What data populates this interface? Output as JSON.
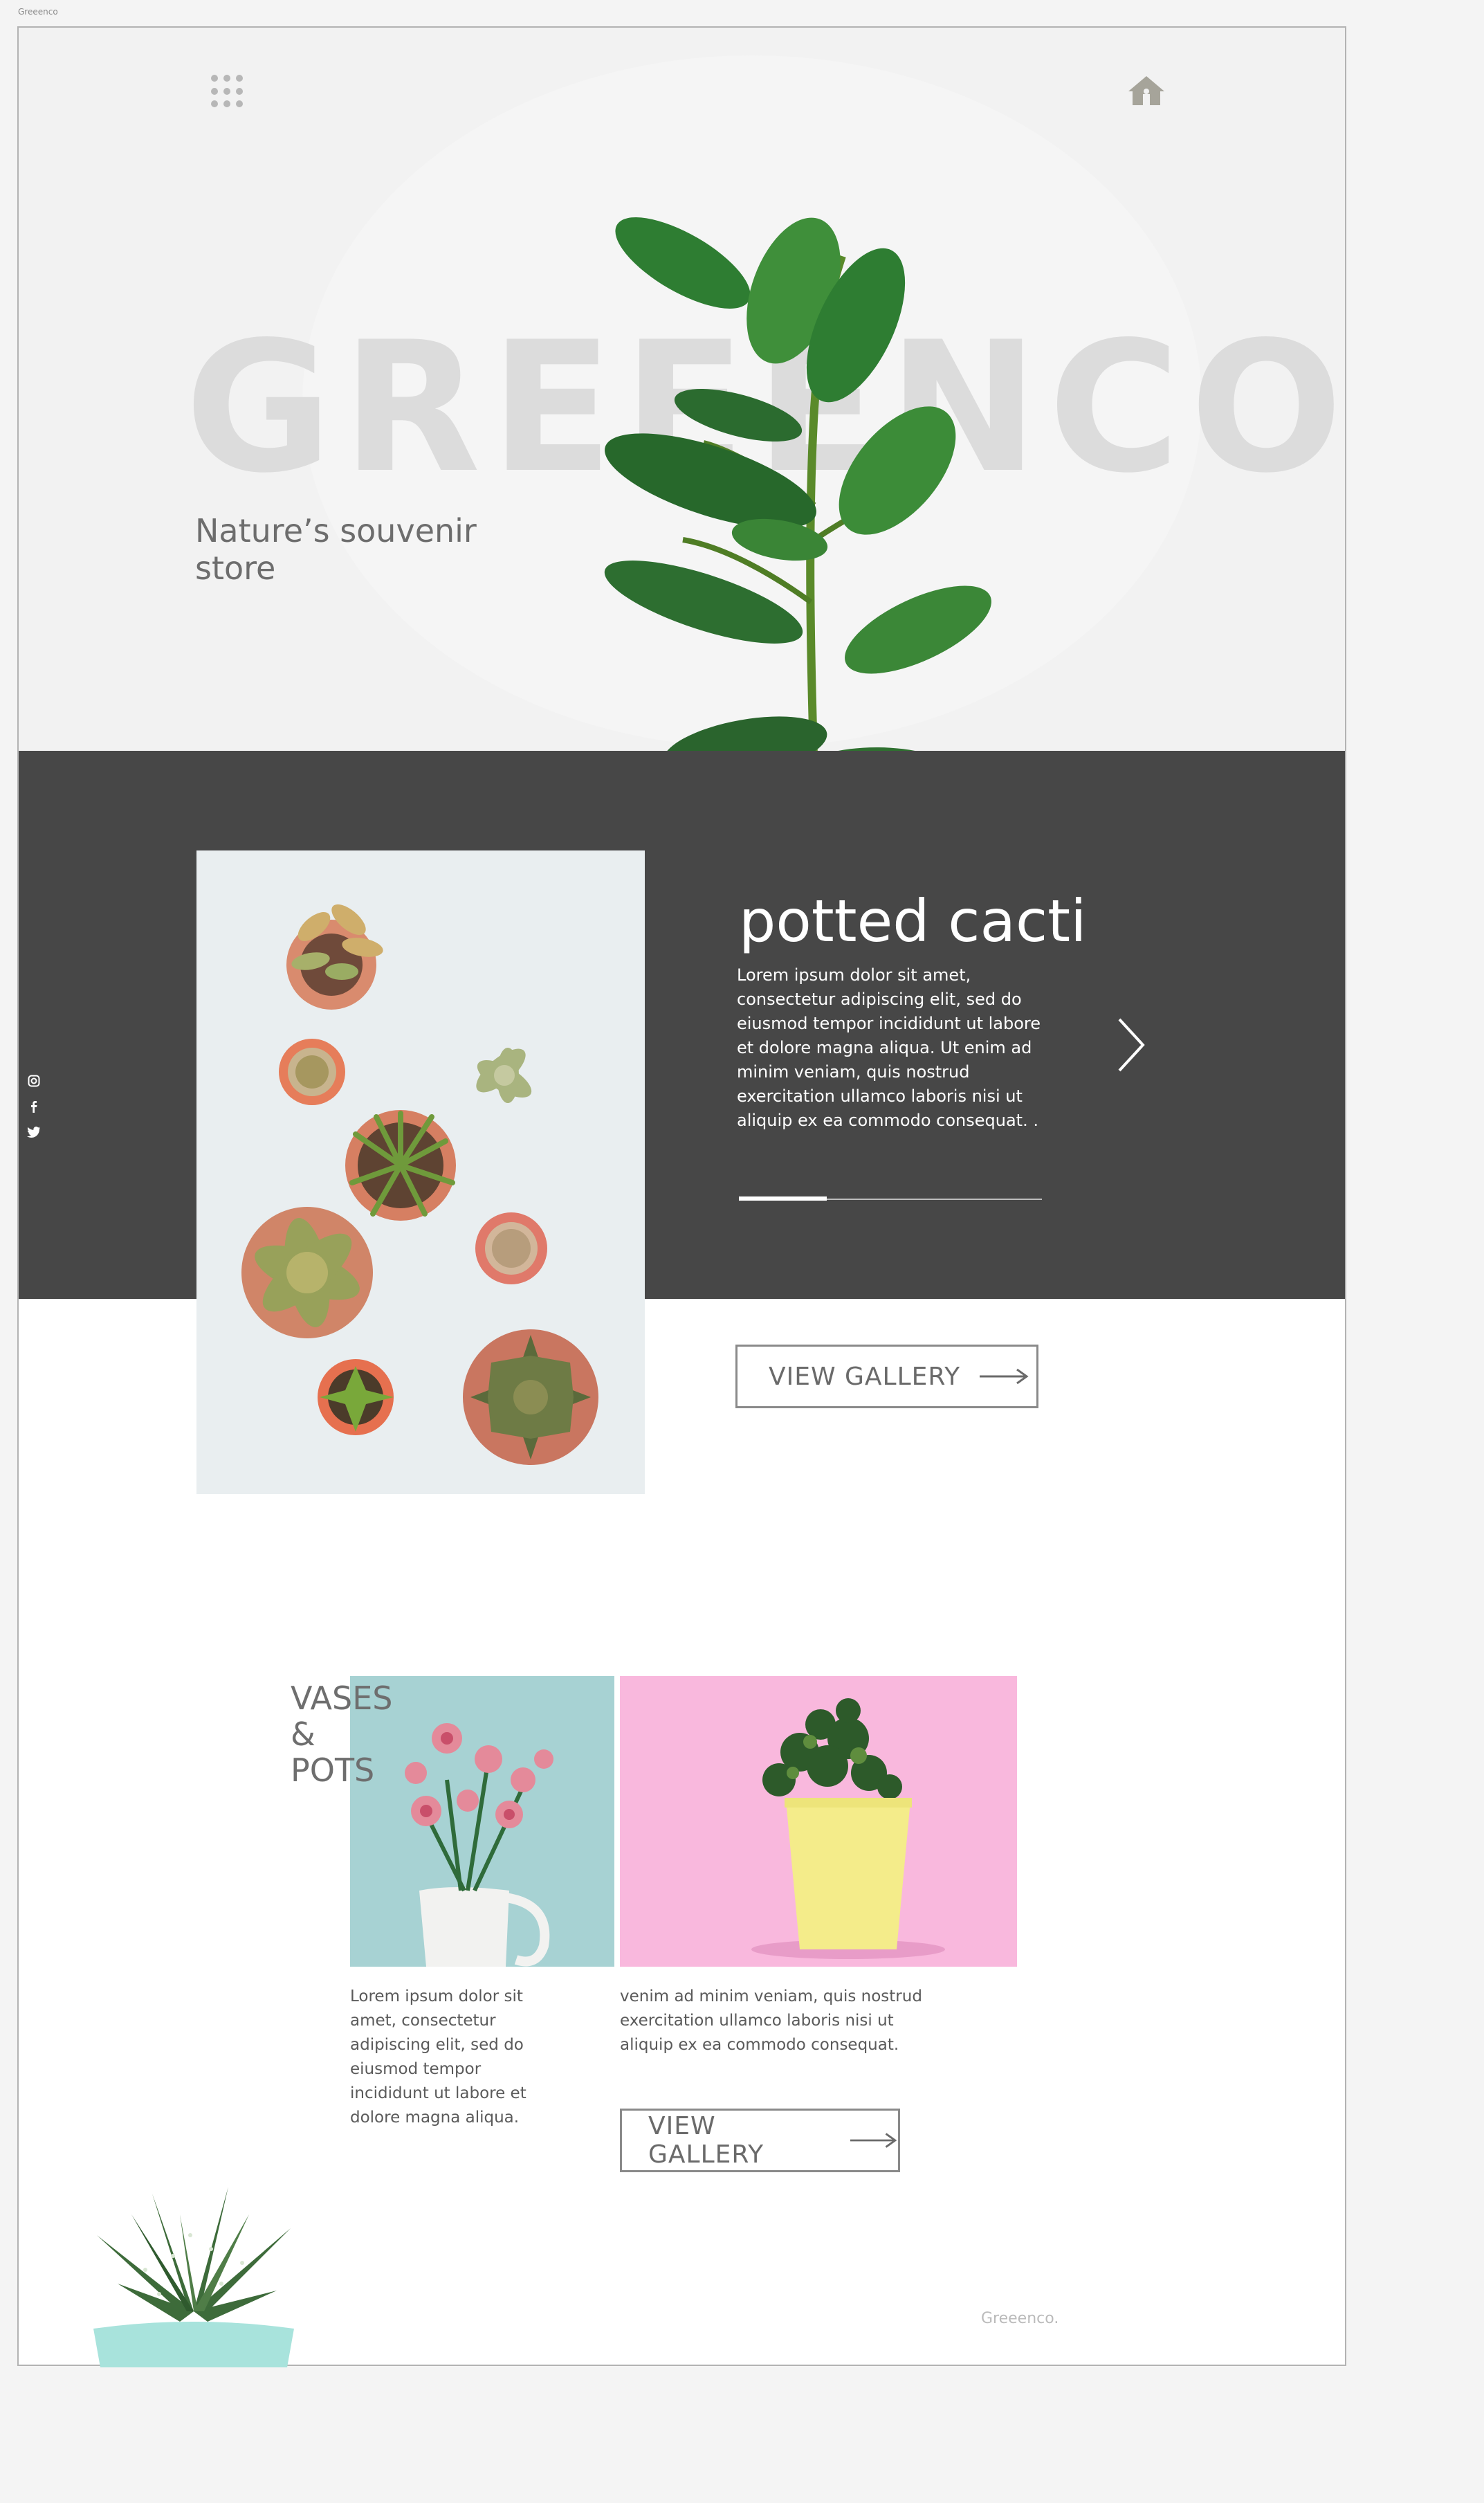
{
  "window_title": "Greeenco",
  "hero": {
    "brand": "GREEENCO.",
    "tagline": "Nature’s souvenir store",
    "icons": [
      "grid-menu-icon",
      "home-icon"
    ]
  },
  "social": {
    "icons": [
      "instagram-icon",
      "facebook-icon",
      "twitter-icon"
    ]
  },
  "slider": {
    "title": "potted cacti",
    "text": "Lorem ipsum dolor sit amet, consectetur adipiscing elit, sed do eiusmod tempor incididunt ut labore et dolore magna aliqua. Ut enim ad minim veniam, quis nostrud exercitation ullamco laboris nisi ut aliquip ex ea commodo consequat. .",
    "progress": 0.29,
    "next_icon": "chevron-right-icon"
  },
  "gallery_button_1": {
    "label": "VIEW GALLERY",
    "icon": "arrow-right-icon"
  },
  "vases": {
    "title_line1": "VASES",
    "title_line2": "&",
    "title_line3": "POTS",
    "text_left": "Lorem ipsum dolor sit amet, consectetur adipiscing elit, sed do eiusmod tempor incididunt ut labore et dolore magna aliqua.",
    "text_right": "venim ad minim veniam, quis nostrud exercitation ullamco laboris nisi ut aliquip ex ea commodo consequat."
  },
  "gallery_button_2": {
    "label": "VIEW GALLERY",
    "icon": "arrow-right-icon"
  },
  "footer": {
    "brand": "Greeenco."
  },
  "colors": {
    "dark_band": "#474747",
    "hero_bg": "#f2f2f2",
    "leaf_green": "#2f7d32",
    "pink": "#f9b8dd",
    "teal": "#a7d2d3"
  }
}
